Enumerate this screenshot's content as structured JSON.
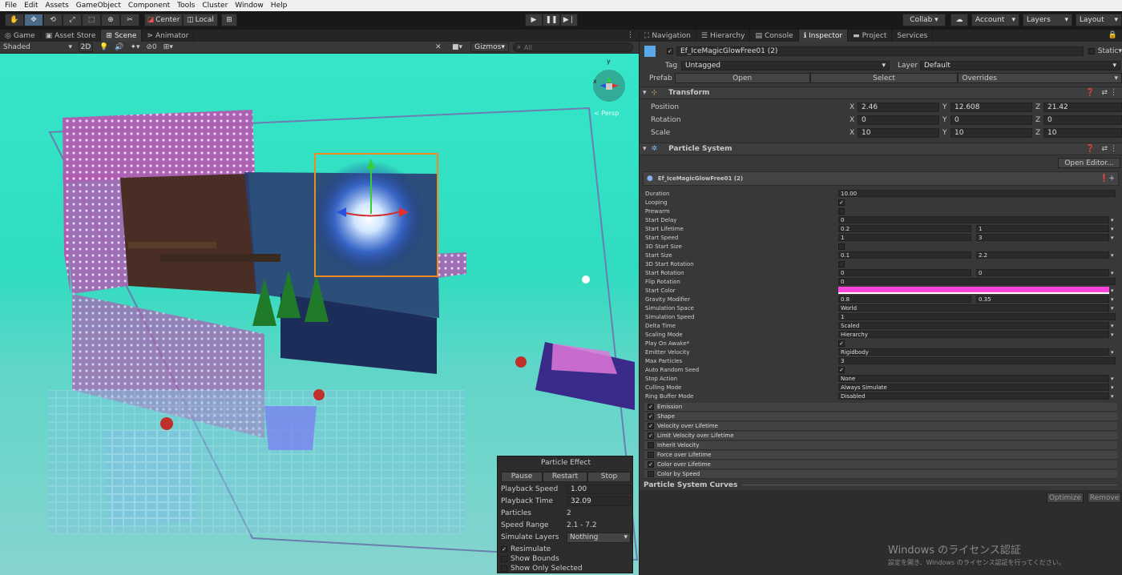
{
  "menu": [
    "File",
    "Edit",
    "Assets",
    "GameObject",
    "Component",
    "Tools",
    "Cluster",
    "Window",
    "Help"
  ],
  "toolbar": {
    "pivot_label": "Center",
    "space_label": "Local",
    "collab_label": "Collab ▾",
    "account_label": "Account",
    "layers_label": "Layers",
    "layout_label": "Layout"
  },
  "left_tabs": [
    "Game",
    "Asset Store",
    "Scene",
    "Animator"
  ],
  "right_tabs": [
    "Navigation",
    "Hierarchy",
    "Console",
    "Inspector",
    "Project",
    "Services"
  ],
  "scene_toolbar": {
    "shading": "Shaded",
    "mode_2d": "2D",
    "hidden_count": "0",
    "gizmos_label": "Gizmos",
    "search_placeholder": "All"
  },
  "scene": {
    "axis_x": "x",
    "axis_y": "y",
    "persp_label": "< Persp"
  },
  "particle_effect": {
    "title": "Particle Effect",
    "pause": "Pause",
    "restart": "Restart",
    "stop": "Stop",
    "playback_speed_label": "Playback Speed",
    "playback_speed": "1.00",
    "playback_time_label": "Playback Time",
    "playback_time": "32.09",
    "particles_label": "Particles",
    "particles": "2",
    "speed_range_label": "Speed Range",
    "speed_range": "2.1 - 7.2",
    "simulate_layers_label": "Simulate Layers",
    "simulate_layers": "Nothing",
    "resimulate": "Resimulate",
    "show_bounds": "Show Bounds",
    "show_only_selected": "Show Only Selected"
  },
  "inspector": {
    "object_name": "Ef_IceMagicGlowFree01 (2)",
    "static_label": "Static",
    "tag_label": "Tag",
    "tag": "Untagged",
    "layer_label": "Layer",
    "layer": "Default",
    "prefab_label": "Prefab",
    "open": "Open",
    "select": "Select",
    "overrides": "Overrides",
    "transform_title": "Transform",
    "position_label": "Position",
    "rotation_label": "Rotation",
    "scale_label": "Scale",
    "position": {
      "x": "2.46",
      "y": "12.608",
      "z": "21.42"
    },
    "rotation": {
      "x": "0",
      "y": "0",
      "z": "0"
    },
    "scale": {
      "x": "10",
      "y": "10",
      "z": "10"
    },
    "ps_title": "Particle System",
    "open_editor": "Open Editor...",
    "ps_name": "Ef_IceMagicGlowFree01 (2)",
    "curves_title": "Particle System Curves",
    "optimize": "Optimize",
    "remove": "Remove",
    "start_color": "#ff44dd"
  },
  "ps_props": [
    {
      "label": "Duration",
      "value": "10.00"
    },
    {
      "label": "Looping",
      "check": "✓"
    },
    {
      "label": "Prewarm",
      "check": ""
    },
    {
      "label": "Start Delay",
      "value": "0"
    },
    {
      "label": "Start Lifetime",
      "value": "0.2",
      "value2": "1"
    },
    {
      "label": "Start Speed",
      "value": "1",
      "value2": "3"
    },
    {
      "label": "3D Start Size",
      "check": ""
    },
    {
      "label": "Start Size",
      "value": "0.1",
      "value2": "2.2"
    },
    {
      "label": "3D Start Rotation",
      "check": ""
    },
    {
      "label": "Start Rotation",
      "value": "0",
      "value2": "0"
    },
    {
      "label": "Flip Rotation",
      "value": "0"
    },
    {
      "label": "Start Color",
      "color": true
    },
    {
      "label": "Gravity Modifier",
      "value": "0.8",
      "value2": "0.35"
    },
    {
      "label": "Simulation Space",
      "value": "World"
    },
    {
      "label": "Simulation Speed",
      "value": "1"
    },
    {
      "label": "Delta Time",
      "value": "Scaled"
    },
    {
      "label": "Scaling Mode",
      "value": "Hierarchy"
    },
    {
      "label": "Play On Awake*",
      "check": "✓"
    },
    {
      "label": "Emitter Velocity",
      "value": "Rigidbody"
    },
    {
      "label": "Max Particles",
      "value": "3"
    },
    {
      "label": "Auto Random Seed",
      "check": "✓"
    },
    {
      "label": "Stop Action",
      "value": "None"
    },
    {
      "label": "Culling Mode",
      "value": "Always Simulate"
    },
    {
      "label": "Ring Buffer Mode",
      "value": "Disabled"
    }
  ],
  "modules": [
    {
      "label": "Emission",
      "check": "✓"
    },
    {
      "label": "Shape",
      "check": "✓"
    },
    {
      "label": "Velocity over Lifetime",
      "check": "✓"
    },
    {
      "label": "Limit Velocity over Lifetime",
      "check": "✓"
    },
    {
      "label": "Inherit Velocity",
      "check": ""
    },
    {
      "label": "Force over Lifetime",
      "check": ""
    },
    {
      "label": "Color over Lifetime",
      "check": "✓"
    },
    {
      "label": "Color by Speed",
      "check": ""
    }
  ],
  "watermark": {
    "line1": "Windows のライセンス認証",
    "line2": "設定を開き、Windows のライセンス認証を行ってください。"
  }
}
